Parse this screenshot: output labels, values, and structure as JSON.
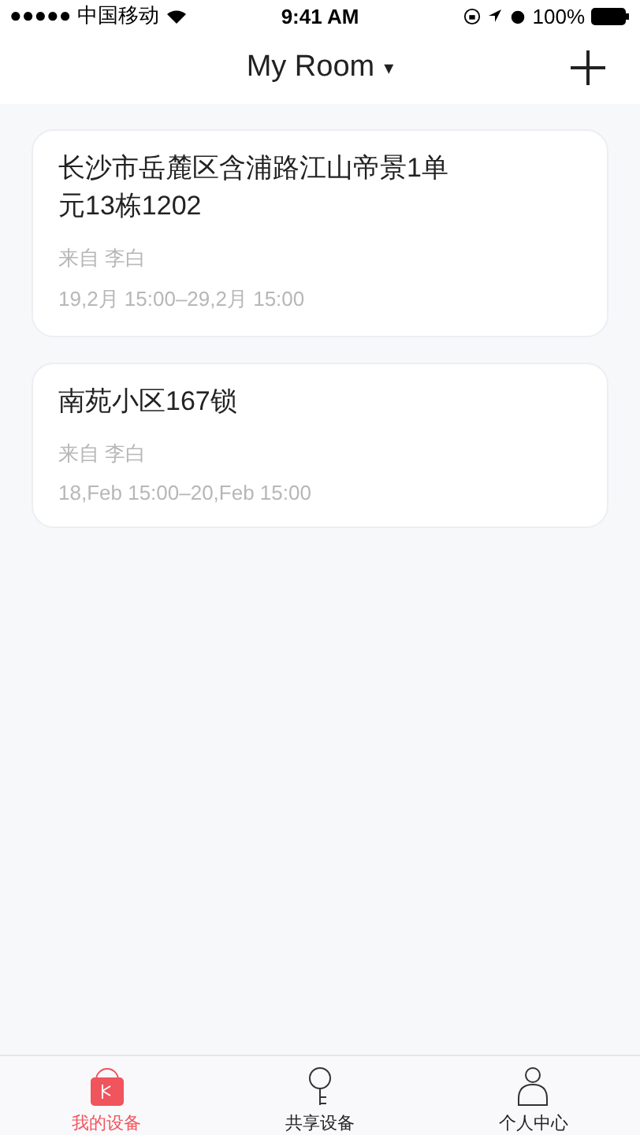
{
  "status_bar": {
    "carrier": "●●●●● 中国移动",
    "time": "9:41 AM",
    "battery": "100%"
  },
  "nav": {
    "title": "My Room",
    "dropdown": "▾"
  },
  "rooms": [
    {
      "name": "长沙市岳麓区含浦路江山帝景1单元13栋1202",
      "from": "来自 李白",
      "period": "19,2月 15:00–29,2月 15:00"
    },
    {
      "name": "南苑小区167锁",
      "from": "来自 李白",
      "period": "18,Feb 15:00–20,Feb 15:00"
    }
  ],
  "tabs": [
    {
      "label": "我的设备",
      "kind": "bag",
      "selected": true
    },
    {
      "label": "共享设备",
      "kind": "key",
      "selected": false
    },
    {
      "label": "个人中心",
      "kind": "person",
      "selected": false
    }
  ]
}
